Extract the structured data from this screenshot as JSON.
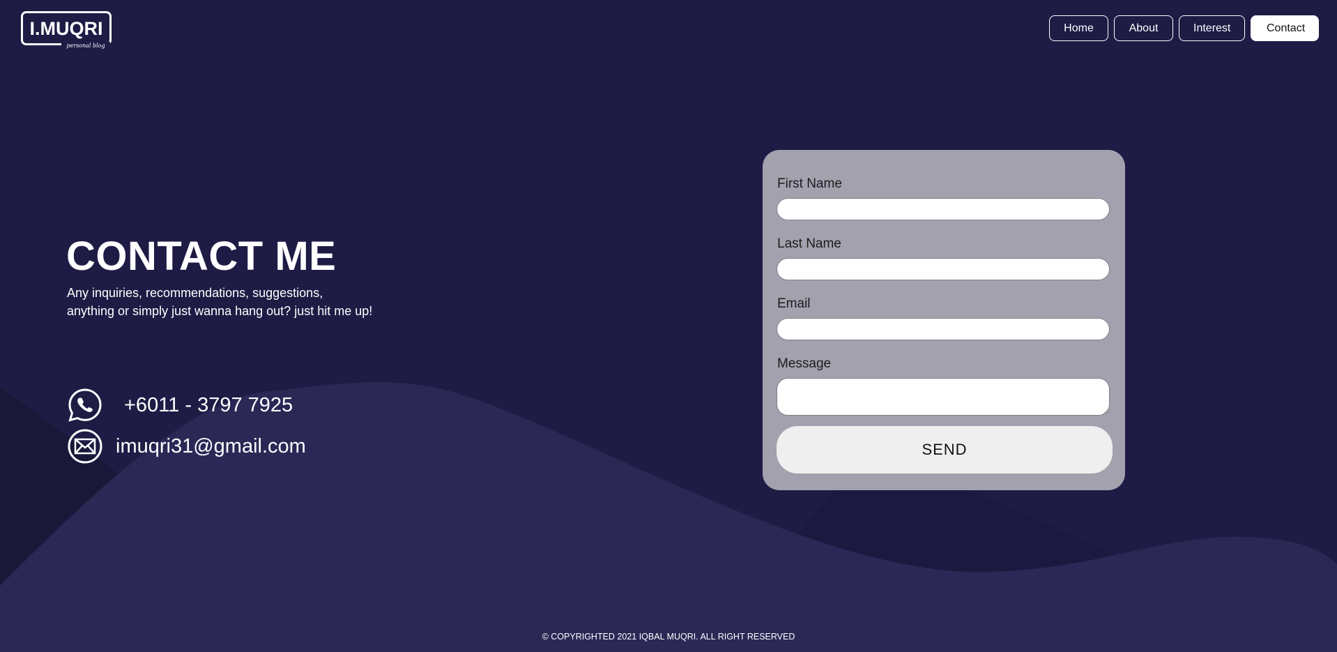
{
  "logo": {
    "main_text": "I.MUQRI",
    "tagline": "personal blog"
  },
  "nav": {
    "items": [
      {
        "label": "Home",
        "active": false
      },
      {
        "label": "About",
        "active": false
      },
      {
        "label": "Interest",
        "active": false
      },
      {
        "label": "Contact",
        "active": true
      }
    ]
  },
  "hero": {
    "title": "CONTACT ME",
    "subtitle_line1": "Any inquiries, recommendations, suggestions,",
    "subtitle_line2": "anything or simply just wanna hang out? just hit me up!"
  },
  "contact_info": {
    "phone": "+6011 - 3797 7925",
    "phone_icon": "whatsapp-icon",
    "email": "imuqri31@gmail.com",
    "email_icon": "mail-icon"
  },
  "form": {
    "first_name_label": "First Name",
    "last_name_label": "Last Name",
    "email_label": "Email",
    "message_label": "Message",
    "first_name_value": "",
    "last_name_value": "",
    "email_value": "",
    "message_value": "",
    "send_label": "SEND"
  },
  "footer": {
    "text": "© COPYRIGHTED 2021 IQBAL MUQRI. ALL RIGHT RESERVED"
  },
  "colors": {
    "background": "#1e1c45",
    "wave": "#2b2856",
    "form_card": "#a3a1ae",
    "text": "#ffffff"
  }
}
